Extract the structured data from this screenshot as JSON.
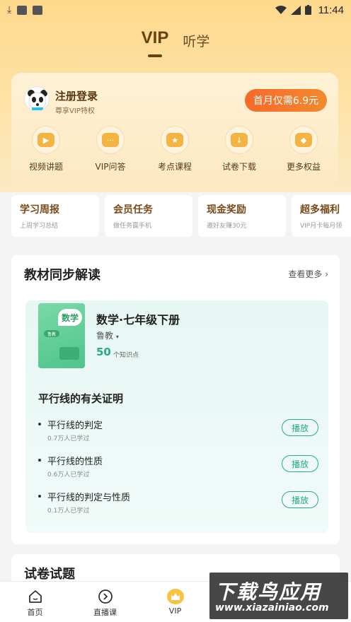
{
  "status_bar": {
    "time": "11:44"
  },
  "top_tabs": [
    {
      "label": "VIP",
      "active": true
    },
    {
      "label": "听学",
      "active": false
    }
  ],
  "vip_card": {
    "login_title": "注册登录",
    "login_subtitle": "尊享VIP特权",
    "promo_button": "首月仅需6.9元",
    "features": [
      {
        "label": "视频讲题",
        "icon": "video-icon"
      },
      {
        "label": "VIP问答",
        "icon": "chat-icon"
      },
      {
        "label": "考点课程",
        "icon": "bulb-icon"
      },
      {
        "label": "试卷下载",
        "icon": "download-icon"
      },
      {
        "label": "更多权益",
        "icon": "gift-icon"
      }
    ]
  },
  "quick_links": [
    {
      "title": "学习周报",
      "subtitle": "上周学习总结"
    },
    {
      "title": "会员任务",
      "subtitle": "做任务赢手机"
    },
    {
      "title": "现金奖励",
      "subtitle": "邀好友赚30元"
    },
    {
      "title": "超多福利",
      "subtitle": "VIP月卡每月领"
    }
  ],
  "textbook_section": {
    "title": "教材同步解读",
    "more": "查看更多",
    "book": {
      "cover_subject": "数学",
      "cover_publisher": "鲁教",
      "title": "数学·七年级下册",
      "publisher": "鲁教",
      "point_count": "50",
      "point_label": "个知识点"
    },
    "chapter_title": "平行线的有关证明",
    "lessons": [
      {
        "name": "平行线的判定",
        "learners": "0.7万人已学过",
        "action": "播放"
      },
      {
        "name": "平行线的性质",
        "learners": "0.6万人已学过",
        "action": "播放"
      },
      {
        "name": "平行线的判定与性质",
        "learners": "0.1万人已学过",
        "action": "播放"
      }
    ]
  },
  "exam_section": {
    "title": "试卷试题"
  },
  "bottom_nav": [
    {
      "label": "首页",
      "icon": "home-icon"
    },
    {
      "label": "直播课",
      "icon": "play-circle-icon"
    },
    {
      "label": "VIP",
      "icon": "vip-crown-icon"
    }
  ],
  "watermark": {
    "main": "下载鸟应用",
    "url": "www.xiazainiao.com"
  },
  "colors": {
    "accent": "#f7692a",
    "teal": "#2aa889",
    "brown": "#6b3f14"
  }
}
